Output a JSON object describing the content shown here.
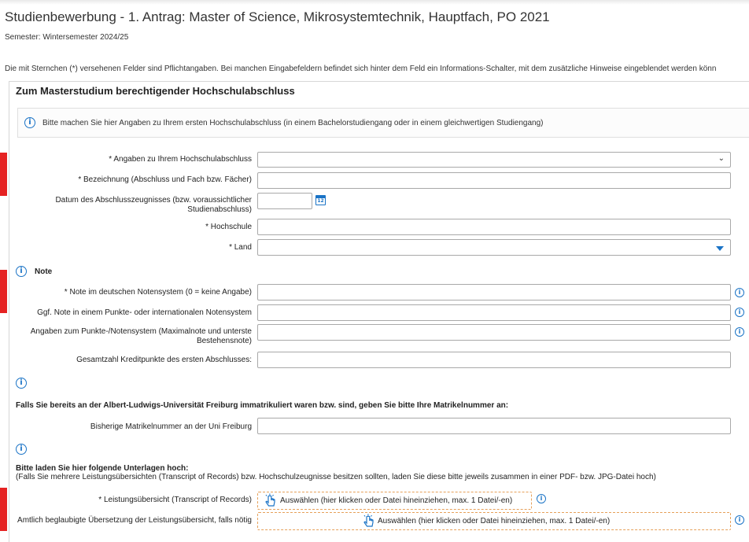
{
  "page": {
    "title": "Studienbewerbung - 1. Antrag: Master of Science, Mikrosystemtechnik, Hauptfach, PO 2021",
    "semester": "Semester: Wintersemester 2024/25",
    "required_notice": "Die mit Sternchen (*) versehenen Felder sind Pflichtangaben. Bei manchen Eingabefeldern befindet sich hinter dem Feld ein Informations-Schalter, mit dem zusätzliche Hinweise eingeblendet werden könn"
  },
  "section": {
    "title": "Zum Masterstudium berechtigender Hochschulabschluss",
    "info_text": "Bitte machen Sie hier Angaben zu Ihrem ersten Hochschulabschluss (in einem Bachelorstudiengang oder in einem gleichwertigen Studiengang)"
  },
  "degree": {
    "angaben_label": "* Angaben zu Ihrem Hochschulabschluss",
    "angaben_value": "",
    "bezeichnung_label": "* Bezeichnung (Abschluss und Fach bzw. Fächer)",
    "bezeichnung_value": "",
    "datum_label": "Datum des Abschlusszeugnisses (bzw. voraussichtlicher Studienabschluss)",
    "datum_value": "",
    "calendar_day": "12",
    "hochschule_label": "* Hochschule",
    "hochschule_value": "",
    "land_label": "* Land",
    "land_value": ""
  },
  "note": {
    "heading": "Note",
    "deutsch_label": "* Note im deutschen Notensystem (0 = keine Angabe)",
    "deutsch_value": "",
    "punkte_label": "Ggf. Note in einem Punkte- oder internationalen Notensystem",
    "punkte_value": "",
    "system_label": "Angaben zum Punkte-/Notensystem (Maximalnote und unterste Bestehensnote)",
    "system_value": "",
    "kredit_label": "Gesamtzahl Kreditpunkte des ersten Abschlusses:",
    "kredit_value": ""
  },
  "matrikel": {
    "heading": "Falls Sie bereits an der Albert-Ludwigs-Universität Freiburg immatrikuliert waren bzw. sind, geben Sie bitte Ihre Matrikelnummer an:",
    "label": "Bisherige Matrikelnummer an der Uni Freiburg",
    "value": ""
  },
  "uploads": {
    "heading": "Bitte laden Sie hier folgende Unterlagen hoch:",
    "subtext": "(Falls Sie mehrere Leistungsübersichten (Transcript of Records) bzw. Hochschulzeugnisse besitzen sollten, laden Sie diese bitte jeweils zusammen in einer PDF- bzw. JPG-Datei hoch)",
    "transcript_label": "* Leistungsübersicht (Transcript of Records)",
    "transcript_button": "Auswählen (hier klicken oder Datei hineinziehen, max. 1 Datei/-en)",
    "translation_label": "Amtlich beglaubigte Übersetzung der Leistungsübersicht, falls nötig",
    "translation_button": "Auswählen (hier klicken oder Datei hineinziehen, max. 1 Datei/-en)"
  },
  "icons": {
    "info_glyph": "i",
    "chevron": "⌄"
  },
  "colors": {
    "accent": "#1a73c6",
    "required_marker": "#e52222",
    "dropzone_border": "#e6a05a"
  }
}
